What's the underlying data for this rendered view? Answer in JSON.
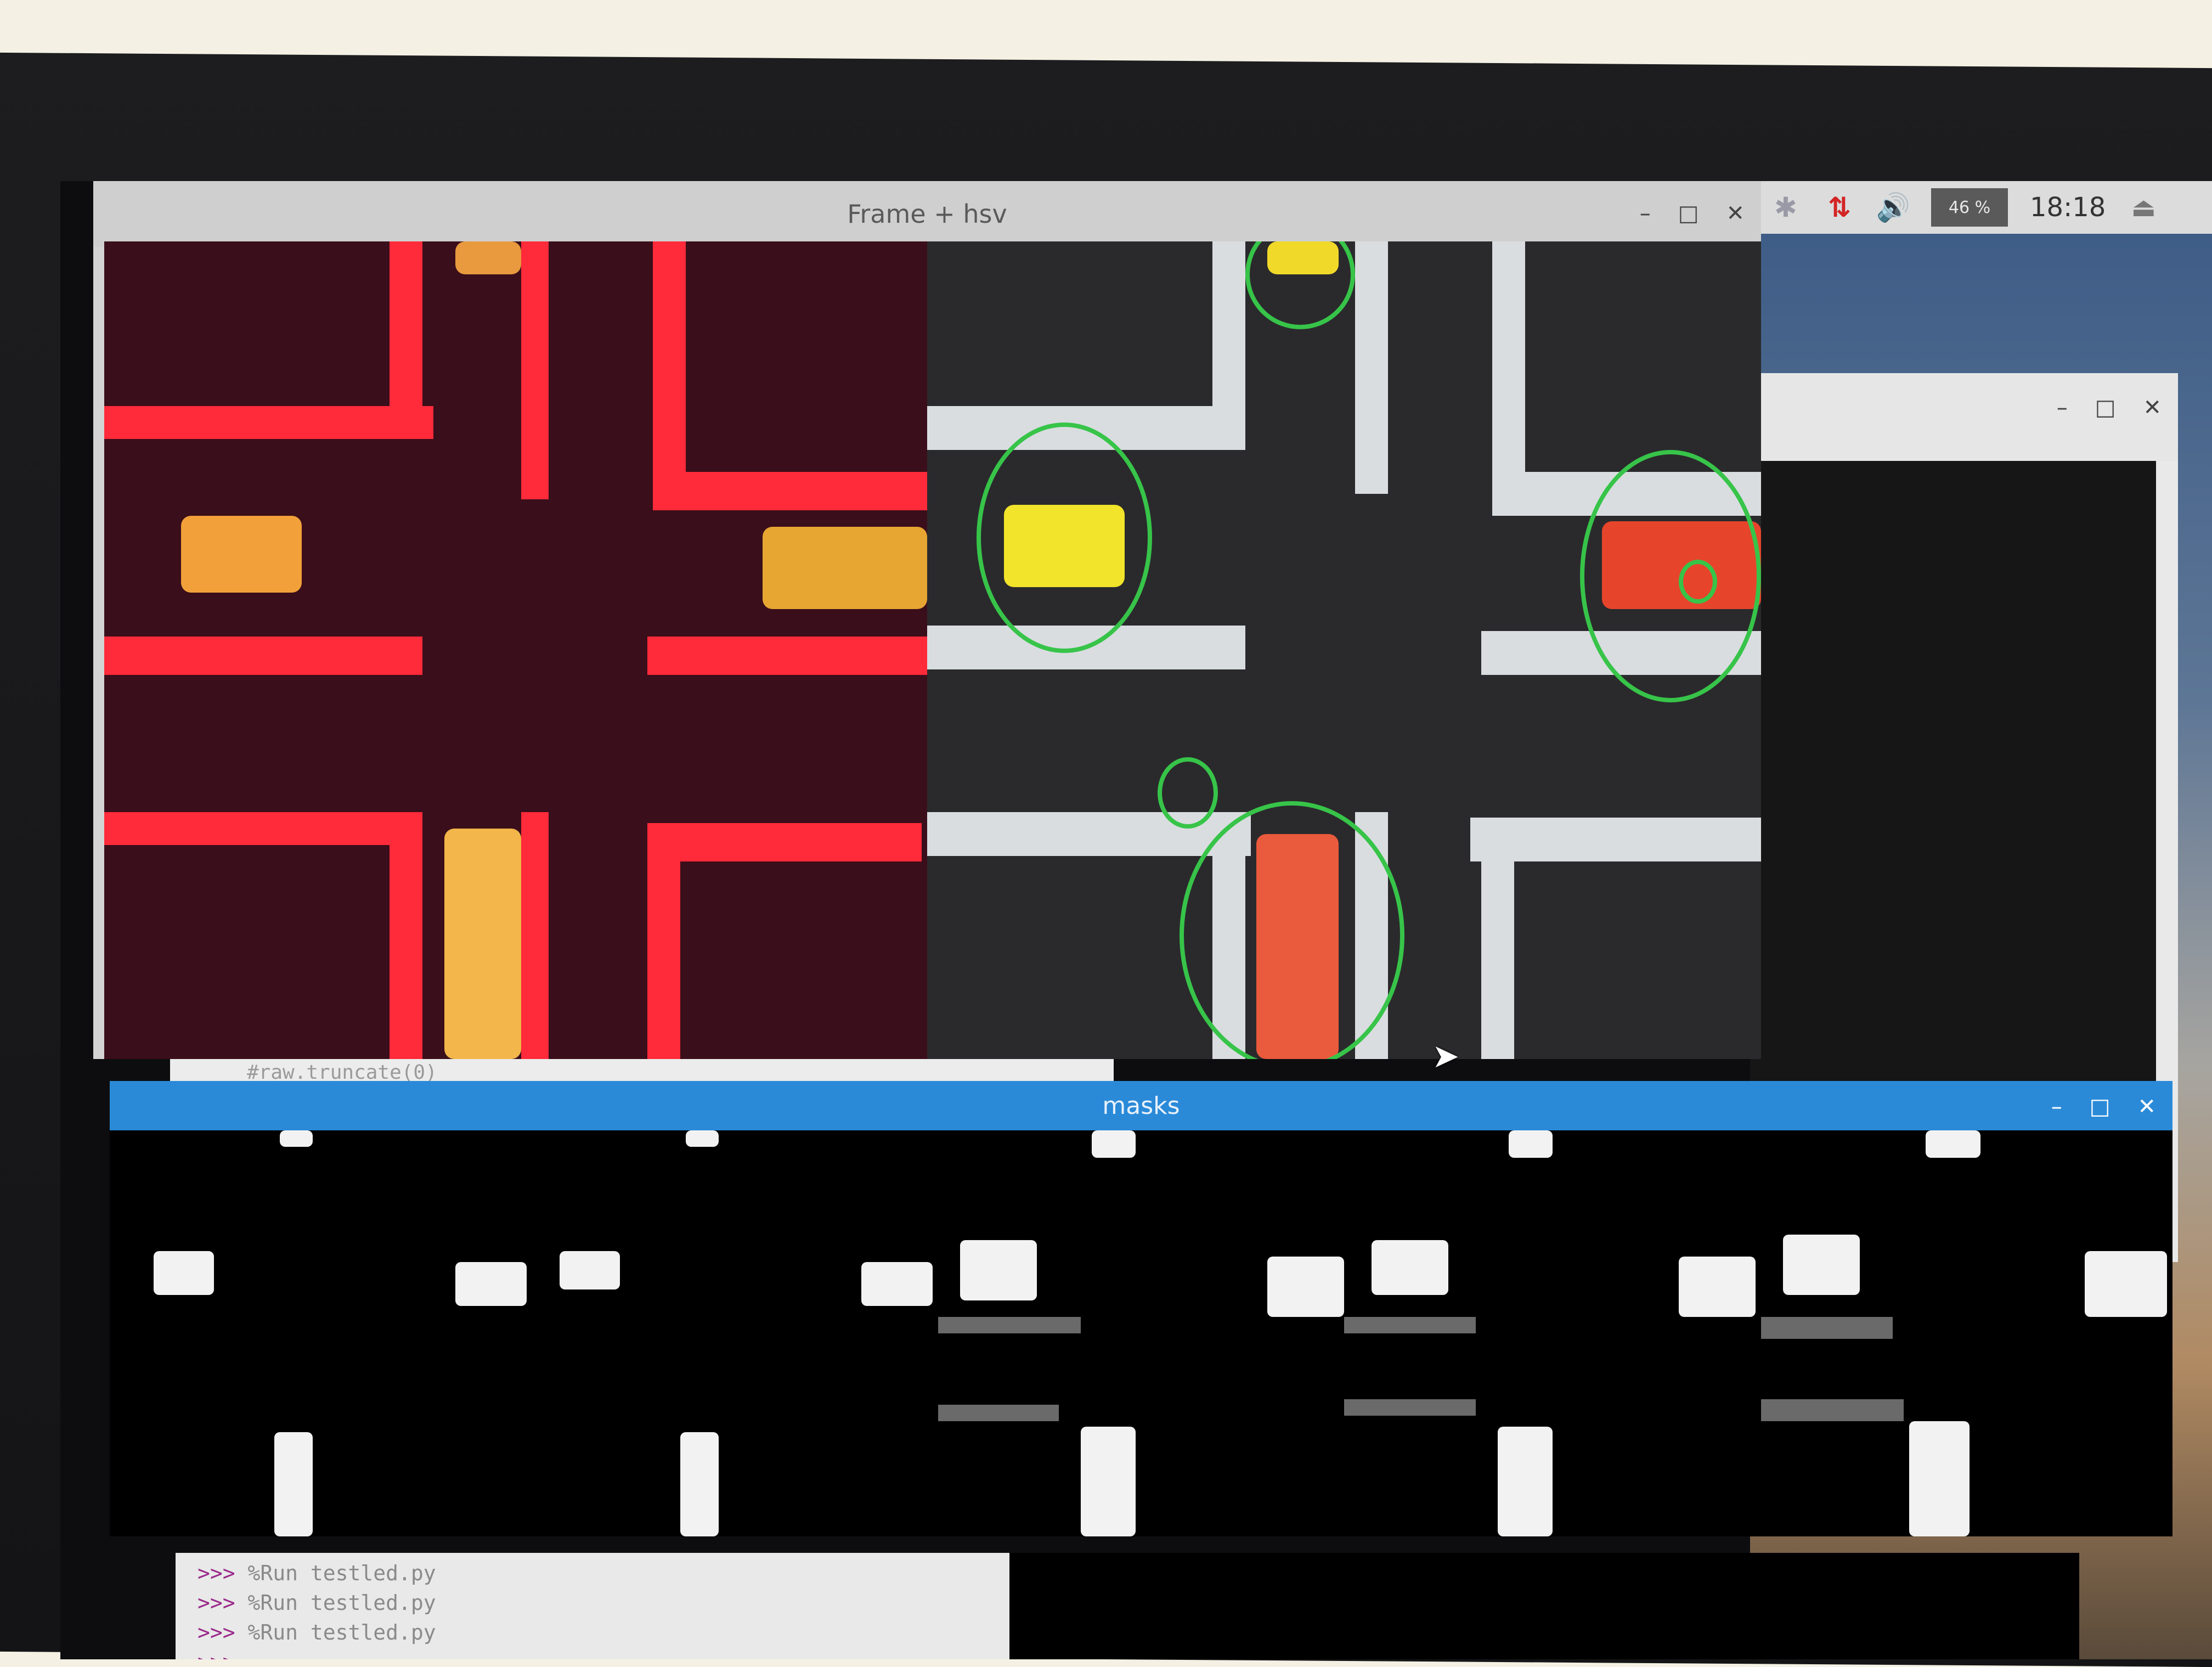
{
  "taskbar": {
    "bluetooth_icon": "✱",
    "network_icon": "⇅",
    "volume_icon": "🔊",
    "cpu_usage": "46 %",
    "clock": "18:18",
    "eject_icon": "⏏"
  },
  "frame_window": {
    "title": "Frame + hsv",
    "minimize": "–",
    "maximize": "□",
    "close": "✕"
  },
  "bg_window": {
    "minimize": "–",
    "maximize": "□",
    "close": "✕"
  },
  "masks_window": {
    "title": "masks",
    "minimize": "–",
    "maximize": "□",
    "close": "✕"
  },
  "editor": {
    "visible_line": "#raw.truncate(0)"
  },
  "shell": {
    "lines": [
      {
        "prompt": ">>>",
        "command": " %Run testled.py"
      },
      {
        "prompt": ">>>",
        "command": " %Run testled.py"
      },
      {
        "prompt": ">>>",
        "command": " %Run testled.py"
      },
      {
        "prompt": ">>>",
        "command": ""
      }
    ]
  },
  "colors": {
    "masks_titlebar": "#2a8ad8",
    "detection_ring": "#37c449",
    "hsv_lines": "#ff2a3a"
  }
}
